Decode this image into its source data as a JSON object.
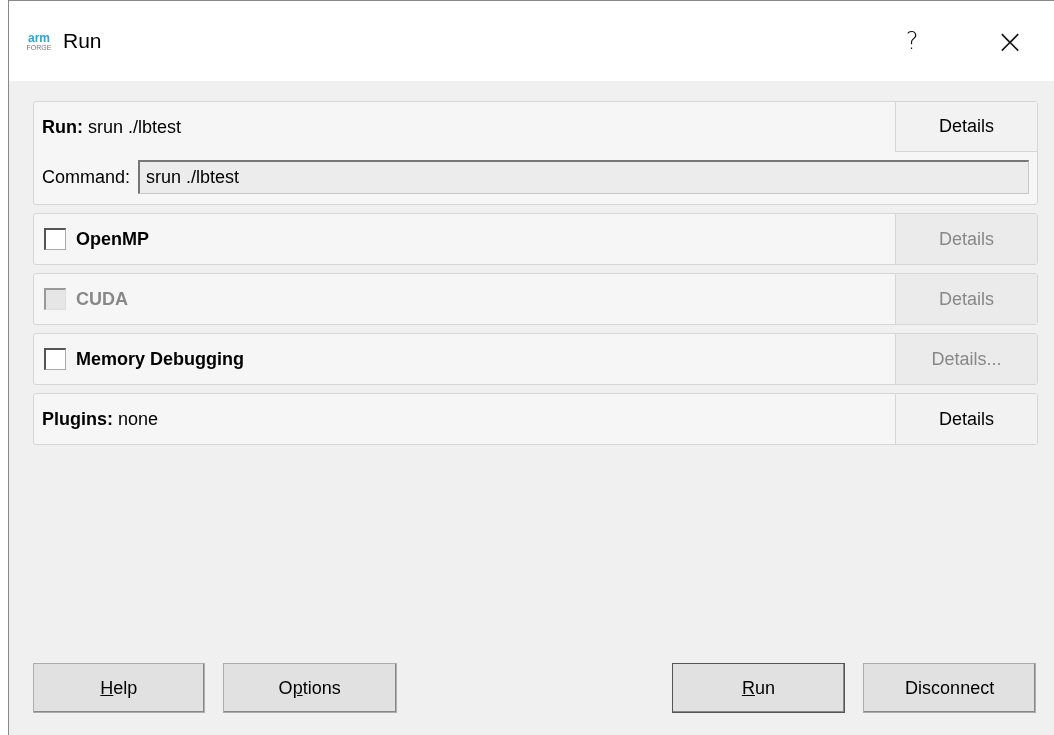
{
  "window": {
    "logo": {
      "top": "arm",
      "bottom": "FORGE"
    },
    "title": "Run",
    "help": "?",
    "close": "×"
  },
  "run_section": {
    "label": "Run:",
    "value": "srun ./lbtest",
    "details": "Details",
    "command": {
      "label": "Command:",
      "value": "srun ./lbtest"
    }
  },
  "options": [
    {
      "kind": "checkbox",
      "label": "OpenMP",
      "checked": false,
      "disabled": false,
      "details": "Details",
      "details_disabled": true
    },
    {
      "kind": "checkbox",
      "label": "CUDA",
      "checked": false,
      "disabled": true,
      "details": "Details",
      "details_disabled": true
    },
    {
      "kind": "checkbox",
      "label": "Memory Debugging",
      "checked": false,
      "disabled": false,
      "details": "Details...",
      "details_disabled": true
    },
    {
      "kind": "info",
      "label": "Plugins:",
      "value": "none",
      "details": "Details",
      "details_disabled": false
    }
  ],
  "buttons": [
    {
      "parts": [
        {
          "text": "H",
          "underline": true
        },
        {
          "text": "elp",
          "underline": false
        }
      ],
      "default": false
    },
    {
      "parts": [
        {
          "text": "O",
          "underline": false
        },
        {
          "text": "p",
          "underline": true
        },
        {
          "text": "tions",
          "underline": false
        }
      ],
      "default": false
    },
    {
      "parts": [
        {
          "text": "R",
          "underline": true
        },
        {
          "text": "un",
          "underline": false
        }
      ],
      "default": true
    },
    {
      "parts": [
        {
          "text": "Disconnect",
          "underline": false
        }
      ],
      "default": false
    }
  ]
}
